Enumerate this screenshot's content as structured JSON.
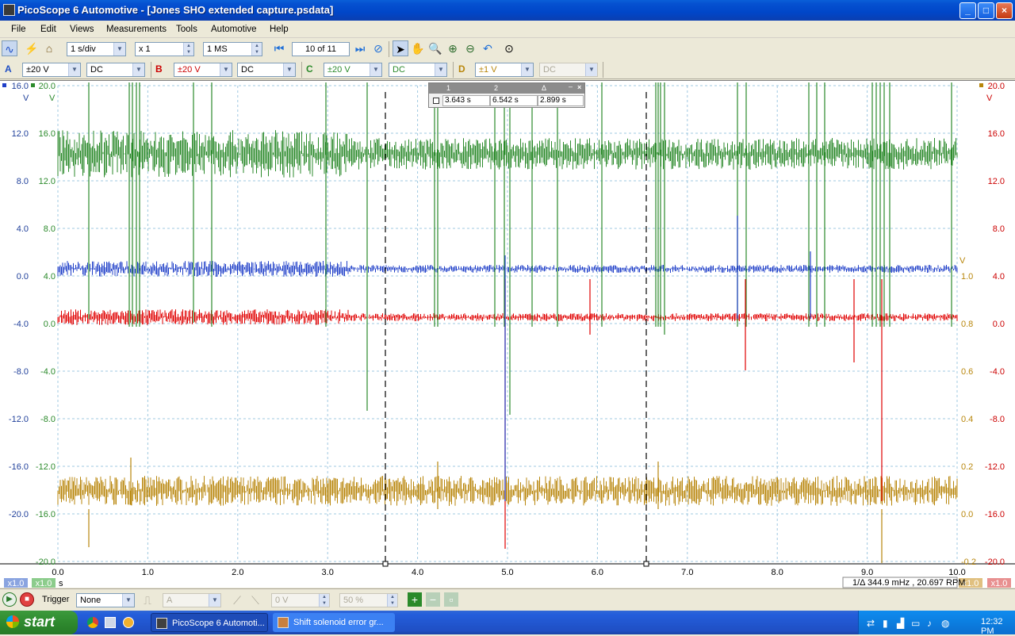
{
  "window": {
    "title": "PicoScope 6 Automotive - [Jones SHO extended capture.psdata]",
    "minimize": "_",
    "maximize": "□",
    "close": "×"
  },
  "menu": [
    "File",
    "Edit",
    "Views",
    "Measurements",
    "Tools",
    "Automotive",
    "Help"
  ],
  "toolbar": {
    "timebase": "1 s/div",
    "zoom": "x 1",
    "samples": "1 MS",
    "buffer": "10 of 11"
  },
  "channels": [
    {
      "id": "A",
      "range": "±20 V",
      "coupling": "DC",
      "color": "#2b8a2b"
    },
    {
      "id": "B",
      "range": "±20 V",
      "coupling": "DC",
      "color": "#cc0000"
    },
    {
      "id": "C",
      "range": "±20 V",
      "coupling": "DC",
      "color": "#2b8a2b"
    },
    {
      "id": "D",
      "range": "±1 V",
      "coupling": "DC",
      "color": "#b8860b"
    }
  ],
  "scope": {
    "axisA_ticks": [
      "16.0",
      "12.0",
      "8.0",
      "4.0",
      "0.0",
      "-4.0",
      "-8.0",
      "-12.0",
      "-16.0",
      "-20.0"
    ],
    "axisC_ticks": [
      "20.0",
      "16.0",
      "12.0",
      "8.0",
      "4.0",
      "0.0",
      "-4.0",
      "-8.0",
      "-12.0",
      "-16.0",
      "-20.0"
    ],
    "axisD_ticks": [
      "1.0",
      "0.8",
      "0.6",
      "0.4",
      "0.2",
      "0.0",
      "-0.2"
    ],
    "axisB_ticks": [
      "20.0",
      "16.0",
      "12.0",
      "8.0",
      "4.0",
      "0.0",
      "-4.0",
      "-8.0",
      "-12.0",
      "-16.0",
      "-20.0"
    ],
    "x_ticks": [
      "0.0",
      "1.0",
      "2.0",
      "3.0",
      "4.0",
      "5.0",
      "6.0",
      "7.0",
      "8.0",
      "9.0",
      "10.0"
    ],
    "unit_v": "V",
    "unit_s": "s",
    "scale_left_a": "x1.0",
    "scale_left_b": "x1.0",
    "scale_right_d": "x1.0",
    "scale_right_b": "x1.0",
    "rotation_readout": "1/Δ 344.9 mHz , 20.697 RPM"
  },
  "rulers": {
    "header": [
      "1",
      "2",
      "Δ"
    ],
    "values": [
      "3.643 s",
      "6.542 s",
      "2.899 s"
    ]
  },
  "bottombar": {
    "trigger_label": "Trigger",
    "trigger_mode": "None",
    "trigger_source": "A",
    "trigger_level": "0 V",
    "pre_trigger": "50 %"
  },
  "taskbar": {
    "start": "start",
    "items": [
      "PicoScope 6 Automoti...",
      "Shift solenoid error gr..."
    ],
    "clock": "12:32 PM"
  }
}
